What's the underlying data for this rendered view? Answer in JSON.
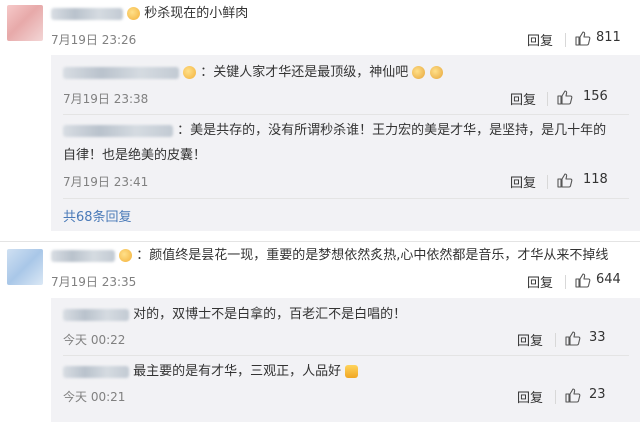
{
  "comments": [
    {
      "text": "秒杀现在的小鲜肉",
      "time": "7月19日 23:26",
      "reply_label": "回复",
      "likes": "811",
      "replies": [
        {
          "text": "：关键人家才华还是最顶级，神仙吧",
          "time": "7月19日 23:38",
          "reply_label": "回复",
          "likes": "156"
        },
        {
          "text_line1": "：美是共存的，没有所谓秒杀谁！王力宏的美是才华，是坚持，是几十年的",
          "text_line2": "自律！也是绝美的皮囊！",
          "time": "7月19日 23:41",
          "reply_label": "回复",
          "likes": "118"
        }
      ],
      "more_replies": "共68条回复"
    },
    {
      "text": "：颜值终是昙花一现，重要的是梦想依然炙热,心中依然都是音乐，才华从来不掉线",
      "time": "7月19日 23:35",
      "reply_label": "回复",
      "likes": "644",
      "replies": [
        {
          "text": "对的，双博士不是白拿的，百老汇不是白唱的！",
          "time": "今天 00:22",
          "reply_label": "回复",
          "likes": "33"
        },
        {
          "text": "最主要的是有才华，三观正，人品好",
          "time": "今天 00:21",
          "reply_label": "回复",
          "likes": "23"
        }
      ]
    }
  ],
  "icons": {
    "like": "thumbs-up-icon",
    "emoji": "emoji-icon",
    "thumbs_emoji": "thumbs-up-emoji-icon"
  },
  "colors": {
    "link": "#4a7ab8",
    "subbox": "#f2f2f5",
    "time": "#808080"
  }
}
